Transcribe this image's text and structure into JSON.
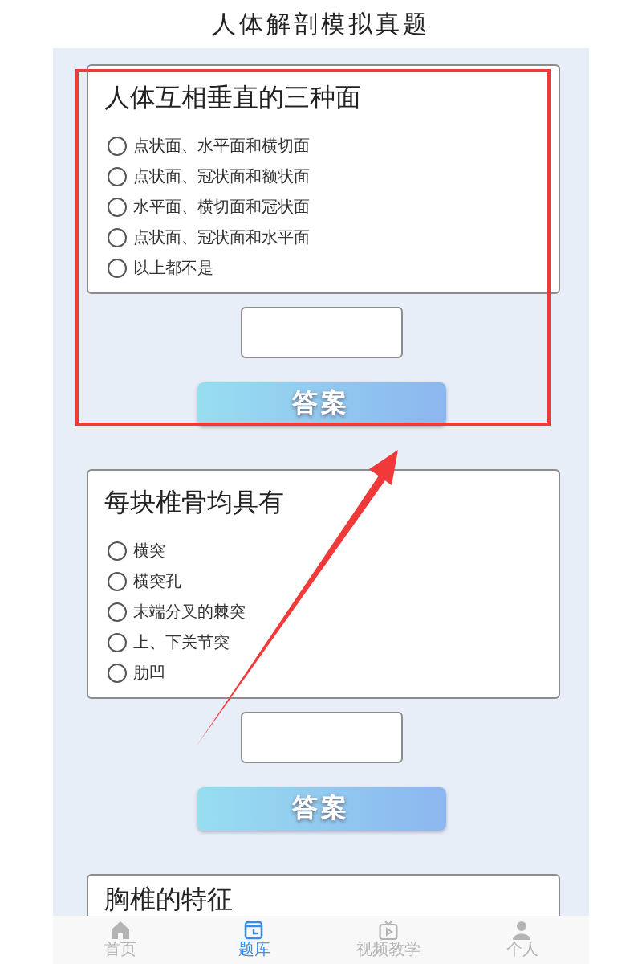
{
  "header": {
    "title": "人体解剖模拟真题"
  },
  "questions": [
    {
      "question": "人体互相垂直的三种面",
      "options": [
        {
          "label": "点状面、水平面和横切面",
          "selected": false
        },
        {
          "label": "点状面、冠状面和额状面",
          "selected": false
        },
        {
          "label": "水平面、横切面和冠状面",
          "selected": false
        },
        {
          "label": "点状面、冠状面和水平面",
          "selected": false
        },
        {
          "label": "以上都不是",
          "selected": false
        }
      ],
      "answer_button": "答案"
    },
    {
      "question": "每块椎骨均具有",
      "options": [
        {
          "label": "横突",
          "selected": false
        },
        {
          "label": "横突孔",
          "selected": false
        },
        {
          "label": "末端分叉的棘突",
          "selected": false
        },
        {
          "label": "上、下关节突",
          "selected": false
        },
        {
          "label": "肋凹",
          "selected": false
        }
      ],
      "answer_button": "答案"
    },
    {
      "question": "胸椎的特征"
    }
  ],
  "tabs": [
    {
      "label": "首页",
      "selected": false
    },
    {
      "label": "题库",
      "selected": true
    },
    {
      "label": "视频教学",
      "selected": false
    },
    {
      "label": "个人",
      "selected": false
    }
  ]
}
